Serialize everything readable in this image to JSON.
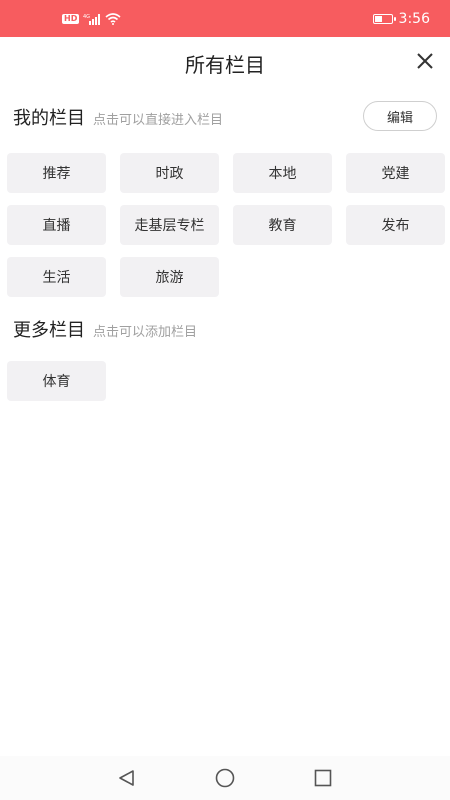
{
  "status_bar": {
    "hd_badge": "HD",
    "network": "4G",
    "battery_level": 0.45,
    "time": "3:56",
    "background": "#f75c5f"
  },
  "header": {
    "title": "所有栏目",
    "close_icon": "close-icon"
  },
  "my_channels": {
    "title": "我的栏目",
    "hint": "点击可以直接进入栏目",
    "edit_label": "编辑",
    "items": [
      "推荐",
      "时政",
      "本地",
      "党建",
      "直播",
      "走基层专栏",
      "教育",
      "发布",
      "生活",
      "旅游"
    ]
  },
  "more_channels": {
    "title": "更多栏目",
    "hint": "点击可以添加栏目",
    "items": [
      "体育"
    ]
  },
  "nav_bar": {
    "icons": [
      "back-triangle-icon",
      "home-circle-icon",
      "recents-square-icon"
    ]
  }
}
